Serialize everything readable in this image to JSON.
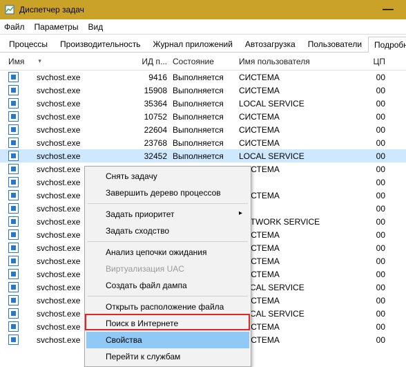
{
  "window": {
    "title": "Диспетчер задач",
    "minimize": "—"
  },
  "menubar": {
    "file": "Файл",
    "options": "Параметры",
    "view": "Вид"
  },
  "tabs": {
    "items": [
      {
        "label": "Процессы"
      },
      {
        "label": "Производительность"
      },
      {
        "label": "Журнал приложений"
      },
      {
        "label": "Автозагрузка"
      },
      {
        "label": "Пользователи"
      },
      {
        "label": "Подробности"
      }
    ],
    "active_index": 5
  },
  "columns": {
    "name": "Имя",
    "pid": "ИД п...",
    "state": "Состояние",
    "user": "Имя пользователя",
    "cpu": "ЦП"
  },
  "processes": [
    {
      "name": "svchost.exe",
      "pid": "9416",
      "state": "Выполняется",
      "user": "СИСТЕМА",
      "cpu": "00"
    },
    {
      "name": "svchost.exe",
      "pid": "15908",
      "state": "Выполняется",
      "user": "СИСТЕМА",
      "cpu": "00"
    },
    {
      "name": "svchost.exe",
      "pid": "35364",
      "state": "Выполняется",
      "user": "LOCAL SERVICE",
      "cpu": "00"
    },
    {
      "name": "svchost.exe",
      "pid": "10752",
      "state": "Выполняется",
      "user": "СИСТЕМА",
      "cpu": "00"
    },
    {
      "name": "svchost.exe",
      "pid": "22604",
      "state": "Выполняется",
      "user": "СИСТЕМА",
      "cpu": "00"
    },
    {
      "name": "svchost.exe",
      "pid": "23768",
      "state": "Выполняется",
      "user": "СИСТЕМА",
      "cpu": "00"
    },
    {
      "name": "svchost.exe",
      "pid": "32452",
      "state": "Выполняется",
      "user": "LOCAL SERVICE",
      "cpu": "00",
      "selected": true
    },
    {
      "name": "svchost.exe",
      "pid": "",
      "state": "",
      "user": "СИСТЕМА",
      "cpu": "00"
    },
    {
      "name": "svchost.exe",
      "pid": "",
      "state": "",
      "user": "",
      "cpu": "00"
    },
    {
      "name": "svchost.exe",
      "pid": "",
      "state": "",
      "user": "СИСТЕМА",
      "cpu": "00"
    },
    {
      "name": "svchost.exe",
      "pid": "",
      "state": "",
      "user": "",
      "cpu": "00"
    },
    {
      "name": "svchost.exe",
      "pid": "",
      "state": "",
      "user": "NETWORK SERVICE",
      "cpu": "00"
    },
    {
      "name": "svchost.exe",
      "pid": "",
      "state": "",
      "user": "СИСТЕМА",
      "cpu": "00"
    },
    {
      "name": "svchost.exe",
      "pid": "",
      "state": "",
      "user": "СИСТЕМА",
      "cpu": "00"
    },
    {
      "name": "svchost.exe",
      "pid": "",
      "state": "",
      "user": "СИСТЕМА",
      "cpu": "00"
    },
    {
      "name": "svchost.exe",
      "pid": "",
      "state": "",
      "user": "СИСТЕМА",
      "cpu": "00"
    },
    {
      "name": "svchost.exe",
      "pid": "",
      "state": "",
      "user": "LOCAL SERVICE",
      "cpu": "00"
    },
    {
      "name": "svchost.exe",
      "pid": "",
      "state": "",
      "user": "СИСТЕМА",
      "cpu": "00"
    },
    {
      "name": "svchost.exe",
      "pid": "",
      "state": "",
      "user": "LOCAL SERVICE",
      "cpu": "00"
    },
    {
      "name": "svchost.exe",
      "pid": "",
      "state": "",
      "user": "СИСТЕМА",
      "cpu": "00"
    },
    {
      "name": "svchost.exe",
      "pid": "",
      "state": "",
      "user": "СИСТЕМА",
      "cpu": "00"
    }
  ],
  "context_menu": {
    "items": [
      {
        "label": "Снять задачу"
      },
      {
        "label": "Завершить дерево процессов"
      },
      {
        "sep": true
      },
      {
        "label": "Задать приоритет",
        "submenu": true
      },
      {
        "label": "Задать сходство"
      },
      {
        "sep": true
      },
      {
        "label": "Анализ цепочки ожидания"
      },
      {
        "label": "Виртуализация UAC",
        "disabled": true
      },
      {
        "label": "Создать файл дампа"
      },
      {
        "sep": true
      },
      {
        "label": "Открыть расположение файла"
      },
      {
        "label": "Поиск в Интернете"
      },
      {
        "label": "Свойства",
        "hover": true
      },
      {
        "label": "Перейти к службам"
      }
    ]
  }
}
